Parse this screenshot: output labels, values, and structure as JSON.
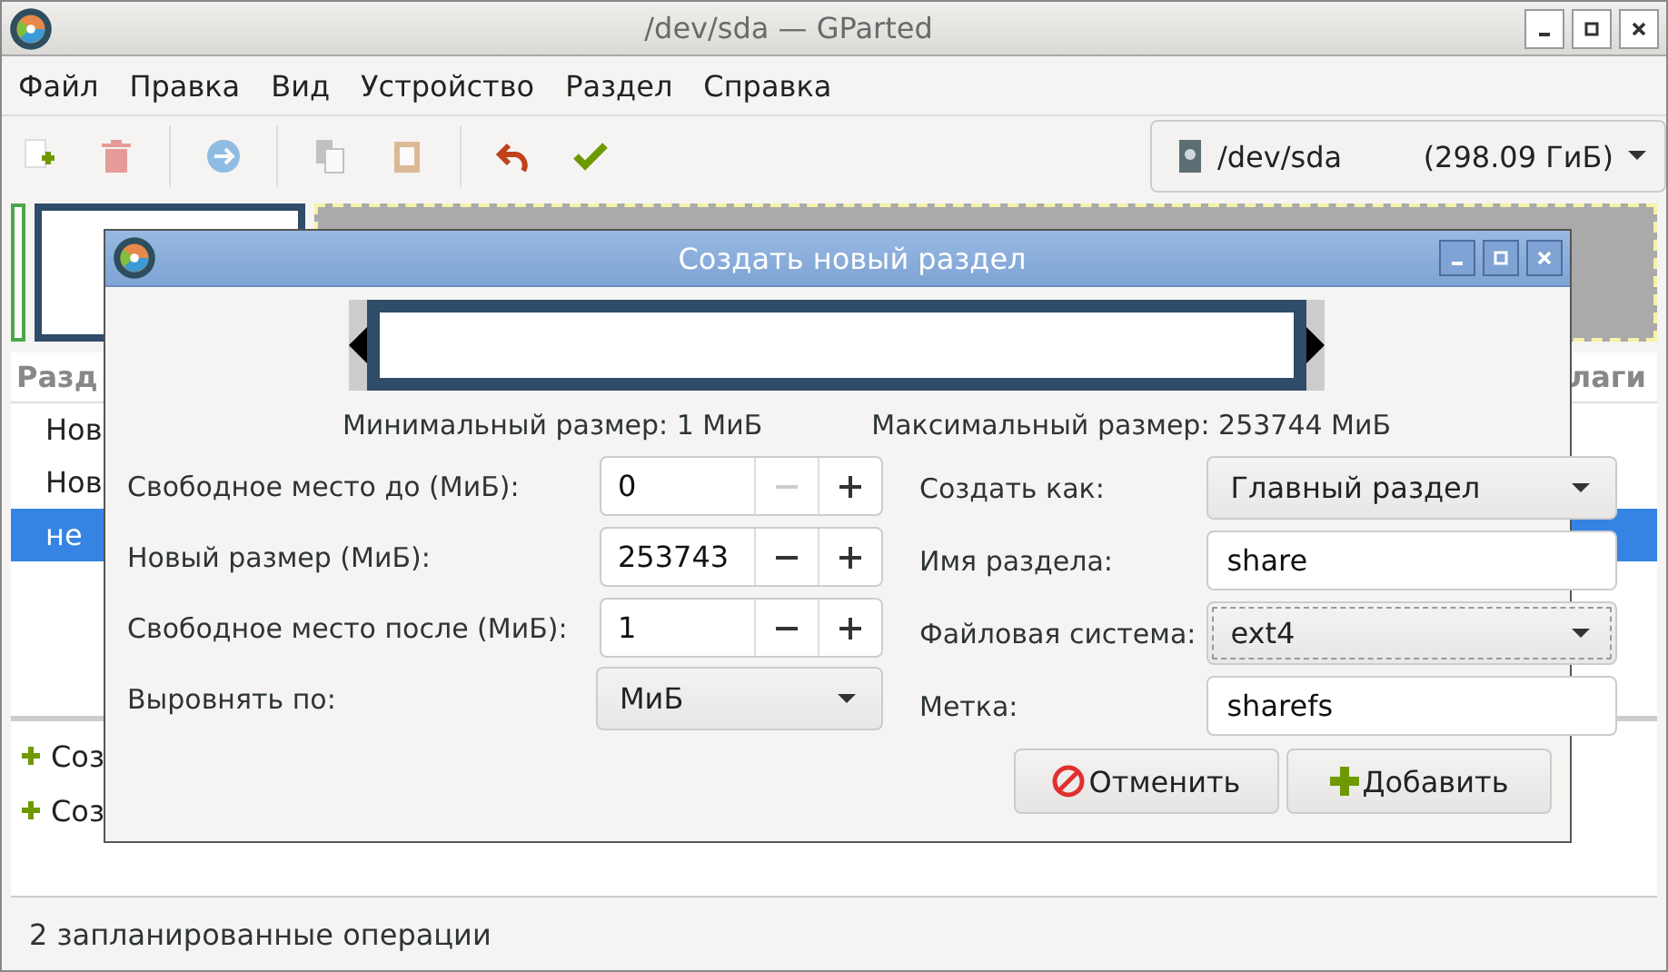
{
  "window": {
    "title": "/dev/sda — GParted"
  },
  "menu": [
    "Файл",
    "Правка",
    "Вид",
    "Устройство",
    "Раздел",
    "Справка"
  ],
  "toolbar": [
    {
      "kind": "new",
      "disabled": false
    },
    {
      "kind": "delete",
      "disabled": true
    },
    {
      "kind": "resize",
      "disabled": true
    },
    {
      "kind": "copy",
      "disabled": true
    },
    {
      "kind": "paste",
      "disabled": true
    },
    {
      "kind": "undo",
      "disabled": false
    },
    {
      "kind": "apply",
      "disabled": false
    }
  ],
  "device": {
    "name": "/dev/sda",
    "size": "(298.09 ГиБ)"
  },
  "partition_list": {
    "columns": [
      "Разд",
      "лаги"
    ],
    "rows": [
      {
        "partition": "Нов",
        "selected": false
      },
      {
        "partition": "Нов",
        "selected": false
      },
      {
        "partition": "не",
        "selected": true
      }
    ]
  },
  "operations": [
    "Соз",
    "Соз"
  ],
  "status_bar": "2 запланированные операции",
  "dialog": {
    "title": "Создать новый раздел",
    "min_size": "Минимальный размер: 1 МиБ",
    "max_size": "Максимальный размер: 253744 МиБ",
    "spins": [
      {
        "label": "Свободное место до (МиБ):",
        "value": "0",
        "minus_disabled": true
      },
      {
        "label": "Новый размер (МиБ):",
        "value": "253743",
        "minus_disabled": false
      },
      {
        "label": "Свободное место после (МиБ):",
        "value": "1",
        "minus_disabled": false
      }
    ],
    "align": {
      "label": "Выровнять по:",
      "value": "МиБ"
    },
    "fields": [
      {
        "kind": "combo",
        "label": "Создать как:",
        "value": "Главный раздел",
        "focused": false
      },
      {
        "kind": "entry",
        "label": "Имя раздела:",
        "value": "share",
        "focused": false
      },
      {
        "kind": "combo",
        "label": "Файловая система:",
        "value": "ext4",
        "focused": true
      },
      {
        "kind": "entry",
        "label": "Метка:",
        "value": "sharefs",
        "focused": false
      }
    ],
    "buttons": [
      {
        "kind": "cancel",
        "label": "Отменить"
      },
      {
        "kind": "add",
        "label": "Добавить"
      }
    ]
  }
}
